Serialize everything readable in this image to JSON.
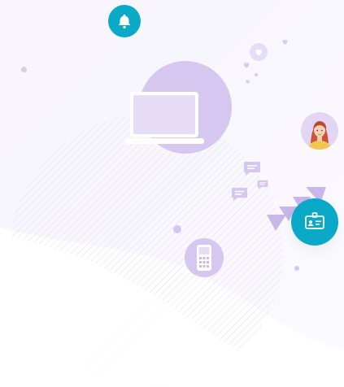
{
  "colors": {
    "teal": "#0aa9c7",
    "lavender": "#d5c7ef",
    "lavender_light": "#e6dcf6",
    "lavender_mid": "#c9b6ea",
    "background": "#f8f6fc",
    "white": "#ffffff"
  },
  "icons": {
    "bell": "bell-icon",
    "laptop": "laptop-icon",
    "avatar": "avatar-woman",
    "id_card": "id-card-icon",
    "phone": "smartphone-icon",
    "heart": "heart-icon",
    "chat": "chat-bubble-icon"
  }
}
